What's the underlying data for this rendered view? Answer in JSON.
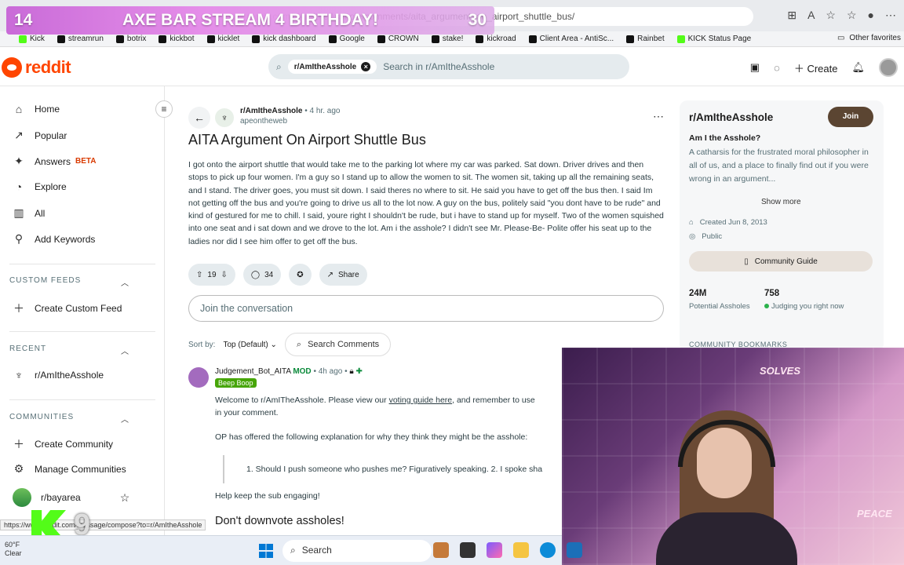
{
  "overlay": {
    "left_num": "14",
    "title": "AXE BAR STREAM 4 BIRTHDAY!",
    "right_num": "30"
  },
  "browser": {
    "url": "reddit.com/r/AmItheAsshole/comments/aita_argument_on_airport_shuttle_bus/",
    "bookmarks": [
      "Kick",
      "streamrun",
      "botrix",
      "kickbot",
      "kicklet",
      "kick dashboard",
      "Google",
      "CROWN",
      "stake!",
      "kickroad",
      "Client Area - AntiSc...",
      "Rainbet",
      "KICK Status Page"
    ],
    "other_favorites": "Other favorites"
  },
  "header": {
    "logo": "reddit",
    "search_chip": "r/AmItheAsshole",
    "search_placeholder": "Search in r/AmItheAsshole",
    "create_label": "Create"
  },
  "sidebar": {
    "nav": [
      {
        "label": "Home",
        "icon": "home-icon"
      },
      {
        "label": "Popular",
        "icon": "popular-icon"
      },
      {
        "label": "Answers",
        "icon": "answers-icon",
        "badge": "BETA"
      },
      {
        "label": "Explore",
        "icon": "explore-icon"
      },
      {
        "label": "All",
        "icon": "all-icon"
      },
      {
        "label": "Add Keywords",
        "icon": "keywords-icon"
      }
    ],
    "custom_feeds_title": "CUSTOM FEEDS",
    "create_custom_feed": "Create Custom Feed",
    "recent_title": "RECENT",
    "recent_item": "r/AmItheAsshole",
    "communities_title": "COMMUNITIES",
    "create_community": "Create Community",
    "manage_communities": "Manage Communities",
    "community_item": "r/bayarea"
  },
  "post": {
    "subreddit": "r/AmItheAsshole",
    "time": "• 4 hr. ago",
    "author": "apeontheweb",
    "title": "AITA Argument On Airport Shuttle Bus",
    "body": "I got onto the airport shuttle that would take me to the parking lot where my car was parked. Sat down. Driver drives and then stops to pick up four women. I'm a guy so I stand up to allow the women to sit. The women sit, taking up all the remaining seats, and I stand. The driver goes, you must sit down. I said theres no where to sit. He said you have to get off the bus then. I said Im not getting off the bus and you're going to drive us all to the lot now. A guy on the bus, politely said \"you dont have to be rude\" and kind of gestured for me to chill. I said, youre right I shouldn't be rude, but i have to stand up for myself. Two of the women squished into one seat and i sat down and we drove to the lot. Am i the asshole? I didn't see Mr. Please-Be- Polite offer his seat up to the ladies nor did I see him offer to get off the bus.",
    "votes": "19",
    "comments": "34",
    "share": "Share",
    "comment_placeholder": "Join the conversation",
    "sort_label": "Sort by:",
    "sort_value": "Top (Default)",
    "search_comments": "Search Comments"
  },
  "comment": {
    "author": "Judgement_Bot_AITA",
    "mod": "MOD",
    "time": "• 4h ago •",
    "flair": "Beep Boop",
    "line1_pre": "Welcome to r/AmITheAsshole. Please view our ",
    "line1_link": "voting guide here",
    "line1_post": ", and remember to use",
    "line2": "in your comment.",
    "line3": "OP has offered the following explanation for why they think they might be the asshole:",
    "quote": "1. Should I push someone who pushes me? Figuratively speaking. 2. I spoke sha",
    "line4": "Help keep the sub engaging!",
    "heading": "Don't downvote assholes!"
  },
  "community": {
    "name": "r/AmItheAsshole",
    "join": "Join",
    "tagline": "Am I the Asshole?",
    "description": "A catharsis for the frustrated moral philosopher in all of us, and a place to finally find out if you were wrong in an argument...",
    "show_more": "Show more",
    "created": "Created Jun 8, 2013",
    "visibility": "Public",
    "guide": "Community Guide",
    "members_num": "24M",
    "members_label": "Potential Assholes",
    "online_num": "758",
    "online_label": "Judging you right now",
    "bookmarks_label": "COMMUNITY BOOKMARKS"
  },
  "taskbar": {
    "temp": "60°F",
    "weather": "Clear",
    "search": "Search",
    "status_url": "https://www.reddit.com/message/compose?to=r/AmItheAsshole"
  },
  "stream": {
    "kick_number": "9"
  },
  "webcam_text": [
    "SOLVES",
    "PEACE"
  ]
}
